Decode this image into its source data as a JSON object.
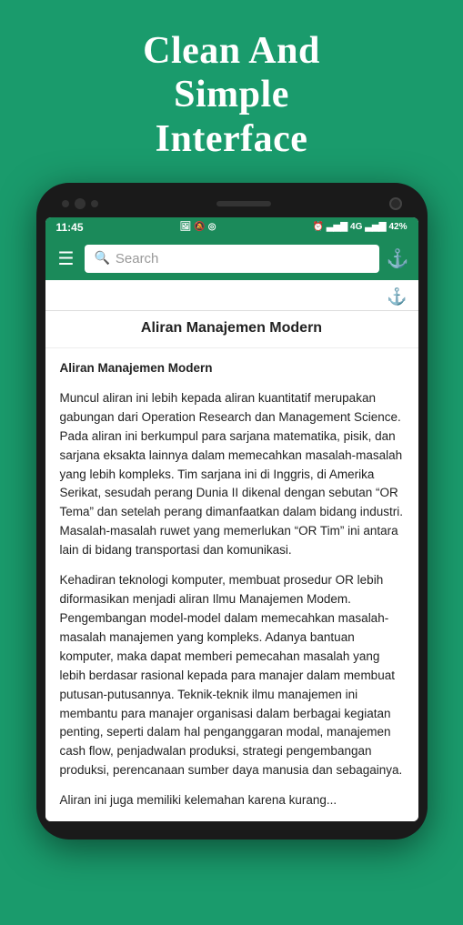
{
  "header": {
    "line1": "Clean And",
    "line2": "Simple Interface"
  },
  "status_bar": {
    "time": "11:45",
    "icons_left": "📷 🔕 ◎",
    "battery": "42%",
    "signal": "4G"
  },
  "app_bar": {
    "search_placeholder": "Search",
    "menu_label": "Menu",
    "bookmark_label": "Bookmark"
  },
  "article": {
    "title": "Aliran Manajemen Modern",
    "bold_heading": "Aliran Manajemen Modern",
    "paragraph1": "Muncul aliran ini lebih kepada aliran kuantitatif merupakan gabungan dari Operation Research dan Management Science. Pada aliran ini berkumpul para sarjana matematika, pisik, dan sarjana eksakta lainnya dalam memecahkan masalah-masalah yang lebih kompleks. Tim sarjana ini di Inggris, di Amerika Serikat, sesudah perang Dunia II dikenal dengan sebutan “OR Tema” dan setelah perang dimanfaatkan dalam bidang industri. Masalah-masalah ruwet yang memerlukan “OR Tim” ini antara lain di bidang transportasi dan komunikasi.",
    "paragraph2": "Kehadiran teknologi komputer, membuat prosedur OR lebih diformasikan menjadi aliran Ilmu Manajemen Modem. Pengembangan model-model dalam memecahkan masalah-masalah manajemen yang kompleks. Adanya bantuan komputer, maka dapat memberi pemecahan masalah yang lebih berdasar rasional kepada para manajer dalam membuat putusan-putusannya. Teknik-teknik ilmu manajemen ini membantu para manajer organisasi dalam berbagai kegiatan penting, seperti dalam hal penganggaran modal, manajemen cash flow, penjadwalan produksi, strategi pengembangan produksi, perencanaan sumber daya manusia dan sebagainya.",
    "paragraph3": "Aliran ini juga memiliki kelemahan karena kurang..."
  }
}
